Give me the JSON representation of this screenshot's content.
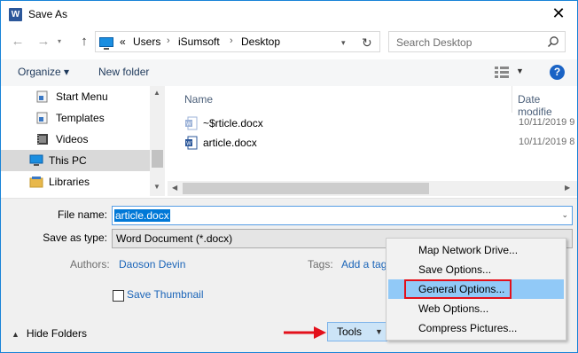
{
  "window": {
    "title": "Save As",
    "app_icon_letter": "W",
    "close_glyph": "✕"
  },
  "nav": {
    "back_glyph": "←",
    "forward_glyph": "→",
    "up_glyph": "↑",
    "recent_glyph": "▾",
    "breadcrumb_prefix": "«",
    "breadcrumb": [
      "Users",
      "iSumsoft",
      "Desktop"
    ],
    "separator": "›",
    "address_drop": "▾",
    "refresh_glyph": "↻",
    "search_placeholder": "Search Desktop"
  },
  "toolbar": {
    "organize_label": "Organize ▾",
    "new_folder_label": "New folder",
    "view_drop": "▼",
    "help_label": "?"
  },
  "sidebar": {
    "items": [
      {
        "label": "Start Menu",
        "icon": "start-menu-icon"
      },
      {
        "label": "Templates",
        "icon": "templates-icon"
      },
      {
        "label": "Videos",
        "icon": "videos-icon"
      },
      {
        "label": "This PC",
        "icon": "this-pc-icon",
        "selected": true
      },
      {
        "label": "Libraries",
        "icon": "libraries-icon"
      }
    ]
  },
  "filelist": {
    "columns": [
      "Name",
      "Date modifie"
    ],
    "files": [
      {
        "name": "~$rticle.docx",
        "date": "10/11/2019 9",
        "icon": "word-temp-file-icon"
      },
      {
        "name": "article.docx",
        "date": "10/11/2019 8",
        "icon": "word-file-icon"
      }
    ]
  },
  "form": {
    "file_name_label": "File name:",
    "file_name_value": "article.docx",
    "save_type_label": "Save as type:",
    "save_type_value": "Word Document (*.docx)",
    "authors_label": "Authors:",
    "authors_value": "Daoson Devin",
    "tags_label": "Tags:",
    "tags_value": "Add a tag",
    "thumbnail_label": "Save Thumbnail",
    "hide_folders_label": "Hide Folders",
    "hide_folders_glyph": "▲",
    "tools_label": "Tools",
    "tools_drop": "▼",
    "combo_drop": "⌄"
  },
  "tools_menu": {
    "items": [
      {
        "label": "Map Network Drive..."
      },
      {
        "label": "Save Options..."
      },
      {
        "label": "General Options...",
        "highlighted": true
      },
      {
        "label": "Web Options..."
      },
      {
        "label": "Compress Pictures..."
      }
    ]
  },
  "colors": {
    "accent": "#0078d7",
    "highlight_menu": "#91c9f7",
    "callout": "#e3101b",
    "link": "#1a64b8"
  }
}
